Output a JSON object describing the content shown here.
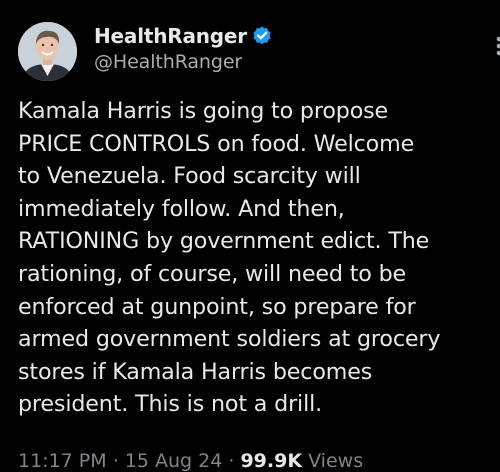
{
  "author": {
    "display_name": "HealthRanger",
    "handle": "@HealthRanger",
    "verified_icon": "verified-badge-icon",
    "verified_color": "#1d9bf0"
  },
  "tweet": {
    "text": "Kamala Harris is going to propose\nPRICE CONTROLS on food. Welcome\nto Venezuela. Food scarcity will\nimmediately follow. And then,\nRATIONING by government edict. The\nrationing, of course, will need to be\nenforced at gunpoint, so prepare for\narmed government soldiers at grocery\nstores if Kamala Harris becomes\npresident. This is not a drill."
  },
  "meta": {
    "time": "11:17 PM",
    "separator": " · ",
    "date": "15 Aug 24",
    "views_count": "99.9K",
    "views_label": " Views"
  },
  "icons": {
    "more": "more-vertical-icon"
  },
  "colors": {
    "background": "#000000",
    "text": "#e7e9ea",
    "secondary": "#a6adb4"
  }
}
